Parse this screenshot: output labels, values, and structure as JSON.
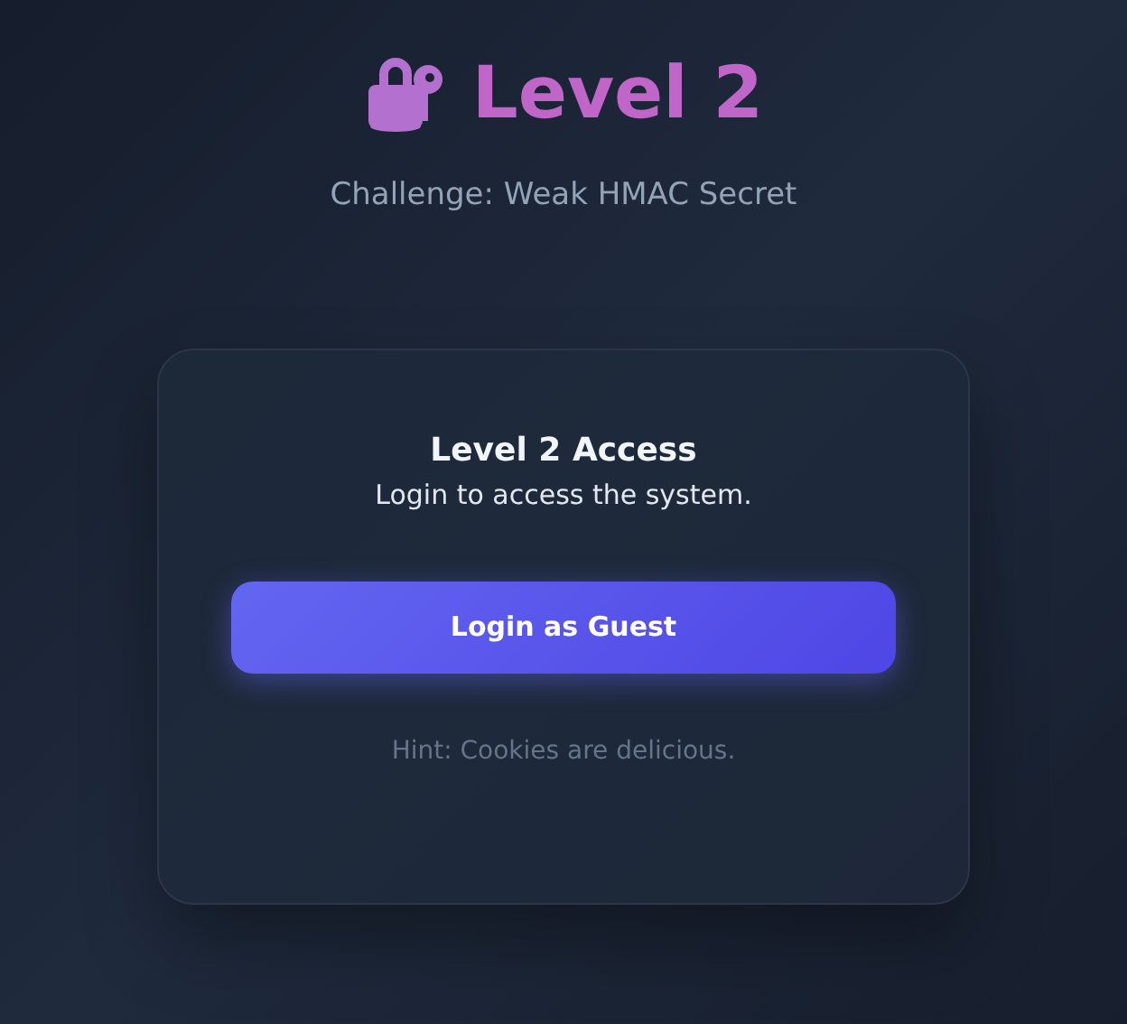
{
  "header": {
    "title": "Level 2",
    "subtitle": "Challenge: Weak HMAC Secret"
  },
  "card": {
    "title": "Level 2 Access",
    "description": "Login to access the system.",
    "button": "Login as Guest",
    "hint": "Hint: Cookies are delicious."
  }
}
